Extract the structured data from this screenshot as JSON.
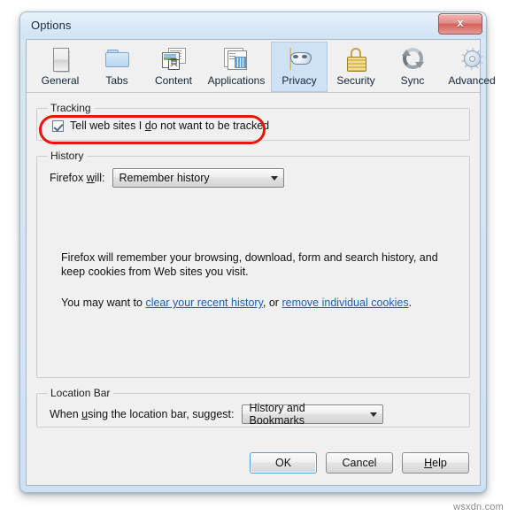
{
  "window": {
    "title": "Options",
    "close_label": "x",
    "close_icon": "close-icon"
  },
  "tabs": [
    {
      "label": "General",
      "icon": "general-icon",
      "selected": false
    },
    {
      "label": "Tabs",
      "icon": "folder-icon",
      "selected": false
    },
    {
      "label": "Content",
      "icon": "content-page-icon",
      "selected": false
    },
    {
      "label": "Applications",
      "icon": "applications-icon",
      "selected": false
    },
    {
      "label": "Privacy",
      "icon": "mask-icon",
      "selected": true
    },
    {
      "label": "Security",
      "icon": "padlock-icon",
      "selected": false
    },
    {
      "label": "Sync",
      "icon": "sync-arrows-icon",
      "selected": false
    },
    {
      "label": "Advanced",
      "icon": "gear-icon",
      "selected": false
    }
  ],
  "content_icon_glyph": "頁",
  "tracking": {
    "legend": "Tracking",
    "checkbox_label_pre": "Tell web sites I ",
    "checkbox_label_accel": "d",
    "checkbox_label_post": "o not want to be tracked",
    "checked": true,
    "annotation_color": "#e8140d"
  },
  "history": {
    "legend": "History",
    "field_label_pre": "Firefox ",
    "field_label_accel": "w",
    "field_label_post": "ill:",
    "dropdown_value": "Remember history",
    "description": "Firefox will remember your browsing, download, form and search history, and keep cookies from Web sites you visit.",
    "links_pre": "You may want to ",
    "link1": "clear your recent history",
    "links_mid": ", or ",
    "link2": "remove individual cookies",
    "links_post": ".",
    "link_color": "#1a5fb4"
  },
  "location_bar": {
    "legend": "Location Bar",
    "field_label_pre": "When ",
    "field_label_accel": "u",
    "field_label_post": "sing the location bar, suggest:",
    "dropdown_value": "History and Bookmarks"
  },
  "footer": {
    "ok": "OK",
    "cancel": "Cancel",
    "help_accel": "H",
    "help_post": "elp"
  },
  "watermark": "wsxdn.com",
  "theme": {
    "selected_tab_bg": "#cfe1f5",
    "panel_bg": "#f0f0f0",
    "titlebar_top": "#e9f2fa",
    "close_red": "#d4605c"
  }
}
